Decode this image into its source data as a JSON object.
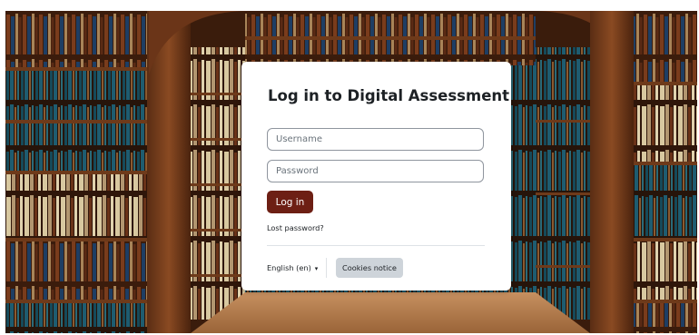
{
  "login": {
    "title": "Log in to Digital Assessment",
    "username_placeholder": "Username",
    "password_placeholder": "Password",
    "login_label": "Log in",
    "lost_password": "Lost password?"
  },
  "footer": {
    "language": "English (en)",
    "cookies_label": "Cookies notice"
  },
  "colors": {
    "primary": "#6d1f14",
    "secondary": "#ced4da"
  },
  "background": {
    "description_icon": "library-bookshelves-background"
  }
}
